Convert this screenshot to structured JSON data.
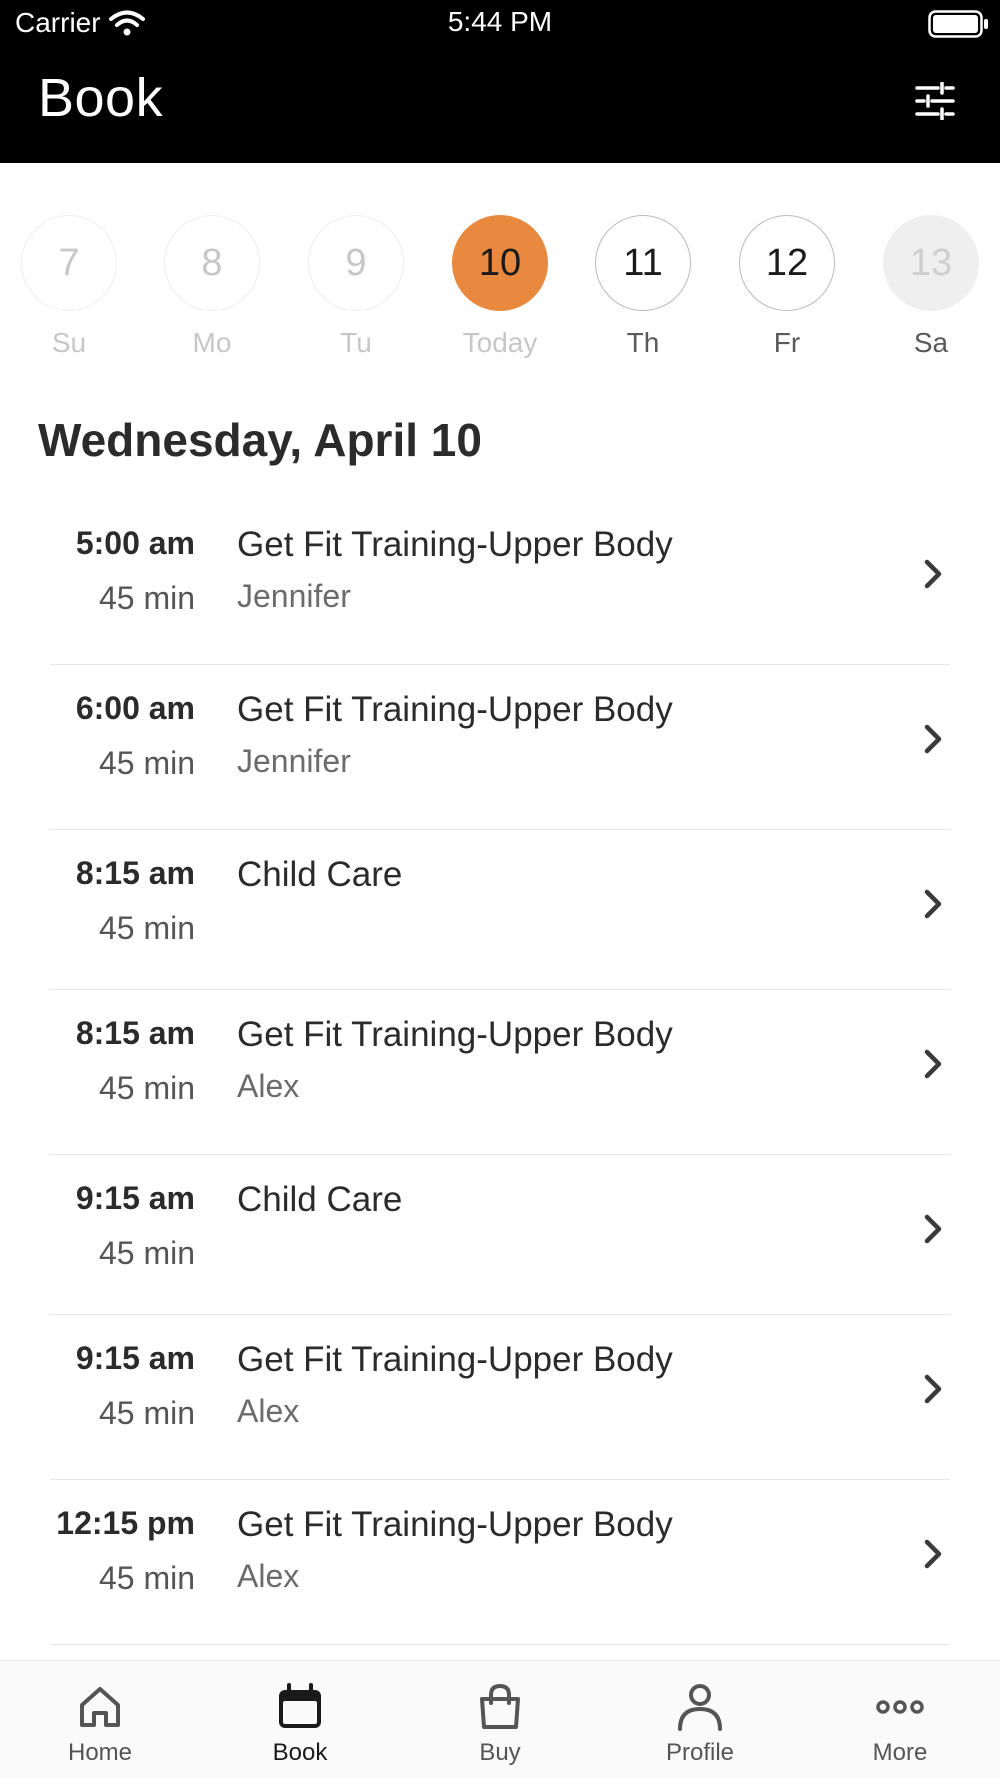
{
  "status_bar": {
    "carrier": "Carrier",
    "time": "5:44 PM"
  },
  "header": {
    "title": "Book",
    "filter_icon": "sliders-icon"
  },
  "week": [
    {
      "num": "7",
      "label": "Su",
      "state": "past"
    },
    {
      "num": "8",
      "label": "Mo",
      "state": "past"
    },
    {
      "num": "9",
      "label": "Tu",
      "state": "past"
    },
    {
      "num": "10",
      "label": "Today",
      "state": "today"
    },
    {
      "num": "11",
      "label": "Th",
      "state": "upcoming"
    },
    {
      "num": "12",
      "label": "Fr",
      "state": "upcoming"
    },
    {
      "num": "13",
      "label": "Sa",
      "state": "unavailable"
    }
  ],
  "date_heading": "Wednesday, April 10",
  "classes": [
    {
      "start": "5:00 am",
      "duration": "45 min",
      "name": "Get Fit Training-Upper Body",
      "instructor": "Jennifer"
    },
    {
      "start": "6:00 am",
      "duration": "45 min",
      "name": "Get Fit Training-Upper Body",
      "instructor": "Jennifer"
    },
    {
      "start": "8:15 am",
      "duration": "45 min",
      "name": "Child Care",
      "instructor": ""
    },
    {
      "start": "8:15 am",
      "duration": "45 min",
      "name": "Get Fit Training-Upper Body",
      "instructor": "Alex"
    },
    {
      "start": "9:15 am",
      "duration": "45 min",
      "name": "Child Care",
      "instructor": ""
    },
    {
      "start": "9:15 am",
      "duration": "45 min",
      "name": "Get Fit Training-Upper Body",
      "instructor": "Alex"
    },
    {
      "start": "12:15 pm",
      "duration": "45 min",
      "name": "Get Fit Training-Upper Body",
      "instructor": "Alex"
    }
  ],
  "tabs": [
    {
      "label": "Home",
      "icon": "home-icon",
      "active": false
    },
    {
      "label": "Book",
      "icon": "calendar-icon",
      "active": true
    },
    {
      "label": "Buy",
      "icon": "bag-icon",
      "active": false
    },
    {
      "label": "Profile",
      "icon": "person-icon",
      "active": false
    },
    {
      "label": "More",
      "icon": "more-icon",
      "active": false
    }
  ],
  "colors": {
    "accent": "#e8893f",
    "header_bg": "#000000",
    "text": "#2b2b2b",
    "muted": "#6b6b6b"
  }
}
